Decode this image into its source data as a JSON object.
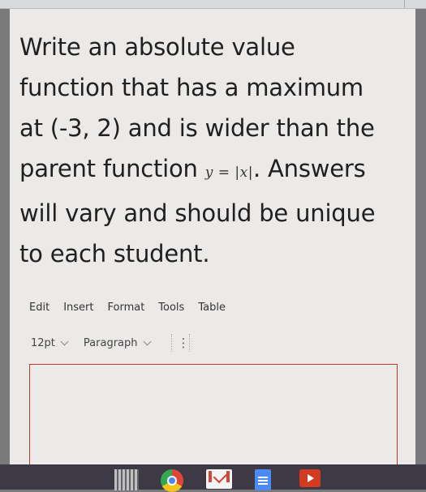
{
  "question": {
    "line1": "Write an absolute value",
    "line2": "function that has a maximum",
    "line3": "at (-3, 2) and is wider than the",
    "line4_pre": "parent function",
    "line4_math": "y = |x|",
    "line4_post": ". Answers",
    "line5": "will vary and should be unique",
    "line6": "to each student."
  },
  "menubar": {
    "items": [
      "Edit",
      "Insert",
      "Format",
      "Tools",
      "Table"
    ]
  },
  "toolbar": {
    "font_size": "12pt",
    "block_format": "Paragraph",
    "more_label": "⋮"
  },
  "editor": {
    "value": "",
    "border_color": "#c8352e"
  },
  "taskbar": {
    "icons": [
      "qr-code-app-icon",
      "chrome-icon",
      "gmail-icon",
      "google-docs-icon",
      "youtube-icon"
    ]
  }
}
